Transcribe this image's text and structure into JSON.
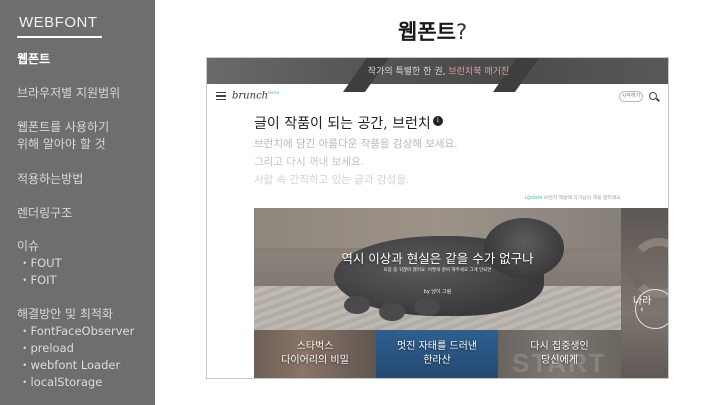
{
  "sidebar": {
    "brand": "WEBFONT",
    "items": [
      {
        "label": "웹폰트",
        "active": true
      },
      {
        "label": "브라우저별 지원범위"
      },
      {
        "label_lines": [
          "웹폰트를 사용하기",
          "위해 알아야 할 것"
        ]
      },
      {
        "label": "적용하는방법"
      },
      {
        "label": "렌더링구조"
      },
      {
        "label": "이슈",
        "subs": [
          "・FOUT",
          "・FOIT"
        ]
      },
      {
        "label": "해결방안 및 최적화",
        "subs": [
          "・FontFaceObserver",
          "・preload",
          "・webfont Loader",
          "・localStorage"
        ]
      }
    ]
  },
  "slide": {
    "title": "웹폰트",
    "title_suffix": "?"
  },
  "screenshot": {
    "banner": {
      "text": "작가의 특별한 한 권,",
      "highlight": "브런치북 매거진"
    },
    "header": {
      "logo": "brunch",
      "logo_sup": "beta",
      "start_button": "시작하기"
    },
    "hero": {
      "title": "글이 작품이 되는 공간, 브런치",
      "badge": "i",
      "lines": [
        "브런치에 담긴 아름다운 작품을 감상해 보세요.",
        "그리고 다시 꺼내 보세요.",
        "서랍 속 간직하고 있는 글과 감성을."
      ],
      "notice_tag": "Update",
      "notice": "브런치 책방에 작가님의 책을 알리세요"
    },
    "feature": {
      "caption": "역시 이상과 현실은 같을 수가 없구나",
      "sub": "요즘 좀 귀찮아 졌어요. 어떻게 준비 해주세요 그게 안되면",
      "byline": "by 냥이 그림"
    },
    "side_panel": {
      "text": "나라",
      "arrow": "‹"
    },
    "cards": [
      {
        "lines": [
          "스타벅스",
          "다이어리의 비밀"
        ]
      },
      {
        "lines": [
          "멋진 자태를 드러낸",
          "한라산"
        ]
      },
      {
        "lines": [
          "다시 집중생인",
          "당신에게"
        ],
        "bg_word": "START"
      }
    ],
    "colors": {
      "accent": "#5bb5b0",
      "banner_highlight": "#e59a9a",
      "sidebar_bg": "#6e6e6e"
    }
  }
}
